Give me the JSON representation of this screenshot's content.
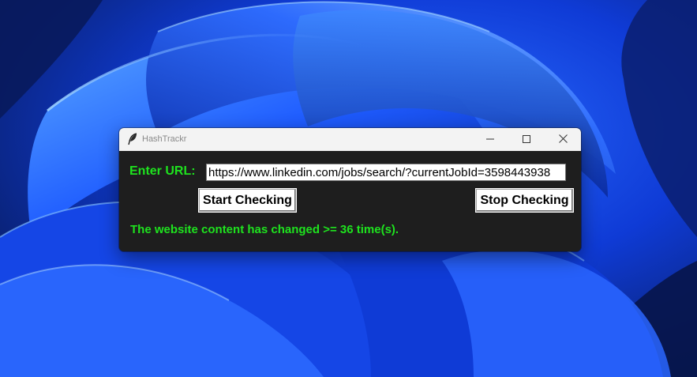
{
  "window": {
    "title": "HashTrackr",
    "app_icon": "feather-icon",
    "controls": {
      "minimize_icon": "minimize-icon",
      "maximize_icon": "maximize-icon",
      "close_icon": "close-icon"
    }
  },
  "form": {
    "url_label": "Enter URL:",
    "url_value": "https://www.linkedin.com/jobs/search/?currentJobId=3598443938",
    "start_button_label": "Start Checking",
    "stop_button_label": "Stop Checking",
    "status_message": "The website content has changed >= 36 time(s)."
  },
  "colors": {
    "label_text": "#1ee31e",
    "client_background": "#1e1e1e",
    "titlebar_background": "#f3f3f3",
    "title_text": "#8a8a8a"
  },
  "desktop": {
    "wallpaper": "windows-11-bloom"
  }
}
